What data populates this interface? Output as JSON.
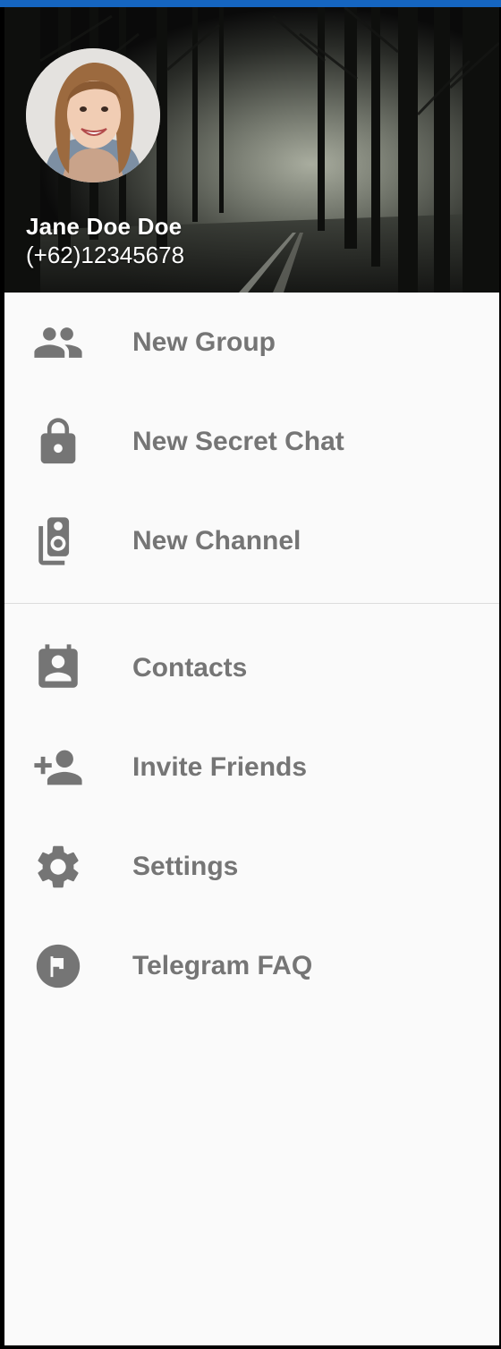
{
  "header": {
    "user_name": "Jane Doe Doe",
    "user_phone": "(+62)12345678"
  },
  "menu_primary": [
    {
      "label": "New Group",
      "icon": "group-icon"
    },
    {
      "label": "New Secret Chat",
      "icon": "lock-icon"
    },
    {
      "label": "New Channel",
      "icon": "speaker-icon"
    }
  ],
  "menu_secondary": [
    {
      "label": "Contacts",
      "icon": "contacts-icon"
    },
    {
      "label": "Invite Friends",
      "icon": "person-add-icon"
    },
    {
      "label": "Settings",
      "icon": "gear-icon"
    },
    {
      "label": "Telegram FAQ",
      "icon": "help-flag-icon"
    }
  ],
  "colors": {
    "accent_bar": "#1565c0",
    "drawer_background": "#fafafa",
    "menu_text": "#757575",
    "icon": "#757575",
    "divider": "#dcdcdc"
  }
}
